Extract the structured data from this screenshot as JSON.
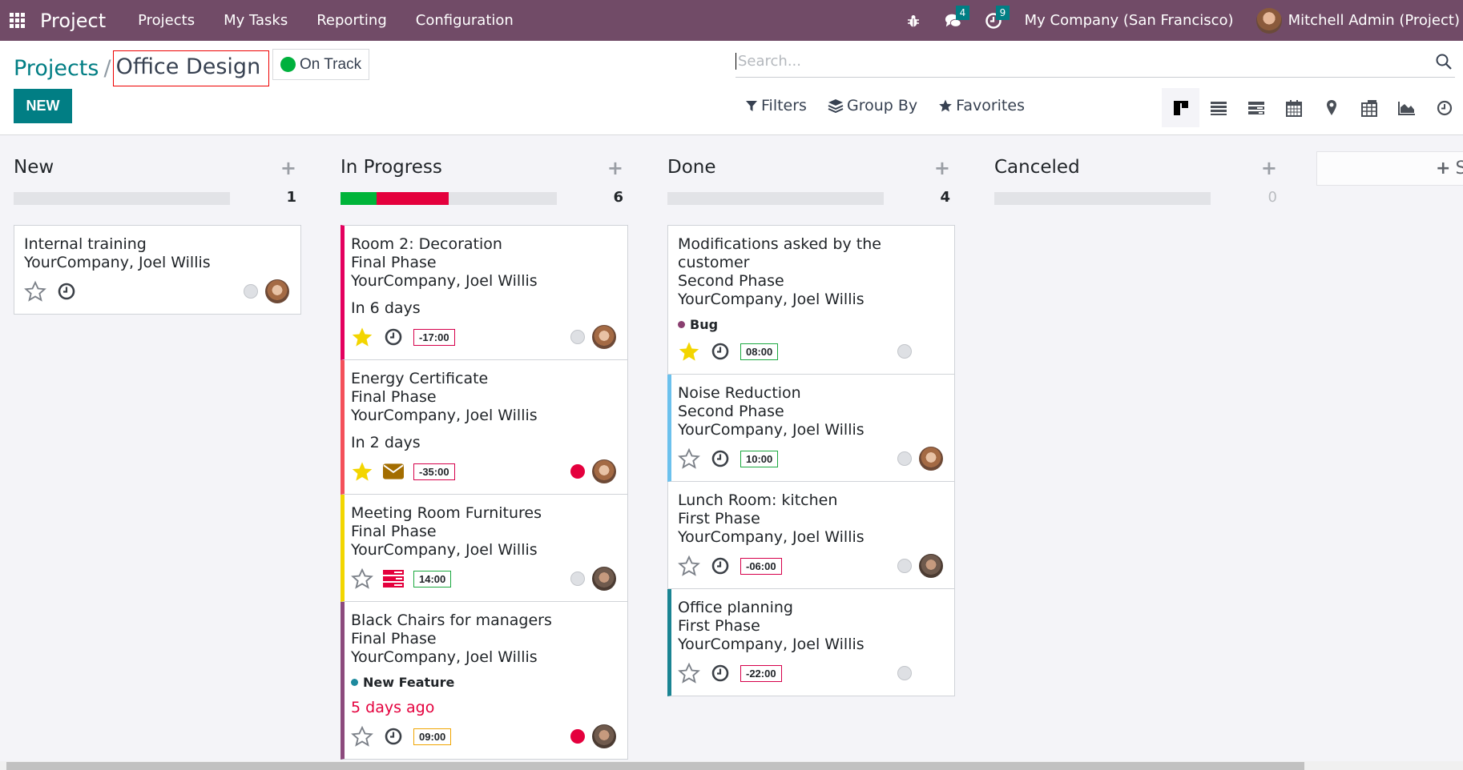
{
  "navbar": {
    "app_name": "Project",
    "menu": [
      "Projects",
      "My Tasks",
      "Reporting",
      "Configuration"
    ],
    "messages_badge": "4",
    "activities_badge": "9",
    "company": "My Company (San Francisco)",
    "user": "Mitchell Admin (Project)",
    "brand_color": "#714b67"
  },
  "breadcrumb": {
    "parent": "Projects",
    "separator": "/",
    "current": "Office Design"
  },
  "status": {
    "label": "On Track",
    "color": "#00b13d"
  },
  "actions": {
    "new_label": "NEW"
  },
  "search": {
    "placeholder": "Search...",
    "value": "",
    "filters_label": "Filters",
    "group_by_label": "Group By",
    "favorites_label": "Favorites"
  },
  "views": [
    {
      "name": "kanban",
      "active": true
    },
    {
      "name": "list",
      "active": false
    },
    {
      "name": "gantt",
      "active": false
    },
    {
      "name": "calendar",
      "active": false
    },
    {
      "name": "map",
      "active": false
    },
    {
      "name": "pivot",
      "active": false
    },
    {
      "name": "graph",
      "active": false
    },
    {
      "name": "activity",
      "active": false
    }
  ],
  "columns": [
    {
      "title": "New",
      "count": "1",
      "progress": {
        "green": 0,
        "red": 0
      },
      "cards": [
        {
          "title": "Internal training",
          "lines": [
            "YourCompany, Joel Willis"
          ],
          "starred": false,
          "activity": "clock",
          "state": "normal",
          "avatar": "a"
        }
      ]
    },
    {
      "title": "In Progress",
      "count": "6",
      "progress": {
        "green": 0.1667,
        "red": 0.3333
      },
      "cards": [
        {
          "title": "Room 2: Decoration",
          "lines": [
            "Final Phase",
            "YourCompany, Joel Willis"
          ],
          "date": "In 6 days",
          "starred": true,
          "activity": "clock",
          "hours": "-17:00",
          "hours_color": "#d6004b",
          "state": "normal",
          "avatar": "a",
          "bar_color": "#e4005e"
        },
        {
          "title": "Energy Certificate",
          "lines": [
            "Final Phase",
            "YourCompany, Joel Willis"
          ],
          "date": "In 2 days",
          "starred": true,
          "activity": "mail",
          "hours": "-35:00",
          "hours_color": "#d6004b",
          "state": "blocked",
          "avatar": "a",
          "bar_color": "#f4505a"
        },
        {
          "title": "Meeting Room Furnitures",
          "lines": [
            "Final Phase",
            "YourCompany, Joel Willis"
          ],
          "starred": false,
          "activity": "todo",
          "hours": "14:00",
          "hours_color": "#1aa83f",
          "state": "normal",
          "avatar": "b",
          "bar_color": "#f2d600"
        },
        {
          "title": "Black Chairs for managers",
          "lines": [
            "Final Phase",
            "YourCompany, Joel Willis"
          ],
          "tag": {
            "label": "New Feature",
            "color": "#1d8a9e"
          },
          "date": "5 days ago",
          "date_overdue": true,
          "starred": false,
          "activity": "clock",
          "hours": "09:00",
          "hours_color": "#f0a500",
          "state": "blocked",
          "avatar": "b",
          "bar_color": "#8c4a7d"
        }
      ]
    },
    {
      "title": "Done",
      "count": "4",
      "progress": {
        "green": 0,
        "red": 0
      },
      "cards": [
        {
          "title": "Modifications asked by the customer",
          "lines": [
            "Second Phase",
            "YourCompany, Joel Willis"
          ],
          "tag": {
            "label": "Bug",
            "color": "#8a3f70"
          },
          "starred": true,
          "activity": "clock",
          "hours": "08:00",
          "hours_color": "#1aa83f",
          "state": "normal"
        },
        {
          "title": "Noise Reduction",
          "lines": [
            "Second Phase",
            "YourCompany, Joel Willis"
          ],
          "starred": false,
          "activity": "clock",
          "hours": "10:00",
          "hours_color": "#1aa83f",
          "state": "normal",
          "avatar": "a",
          "bar_color": "#6cc1ed"
        },
        {
          "title": "Lunch Room: kitchen",
          "lines": [
            "First Phase",
            "YourCompany, Joel Willis"
          ],
          "starred": false,
          "activity": "clock",
          "hours": "-06:00",
          "hours_color": "#d6004b",
          "state": "normal",
          "avatar": "b"
        },
        {
          "title": "Office planning",
          "lines": [
            "First Phase",
            "YourCompany, Joel Willis"
          ],
          "starred": false,
          "activity": "clock",
          "hours": "-22:00",
          "hours_color": "#d6004b",
          "state": "normal",
          "bar_color": "#1a8493"
        }
      ]
    },
    {
      "title": "Canceled",
      "count": "0",
      "progress": {
        "green": 0,
        "red": 0
      },
      "cards": []
    }
  ],
  "add_stage_label": "S"
}
